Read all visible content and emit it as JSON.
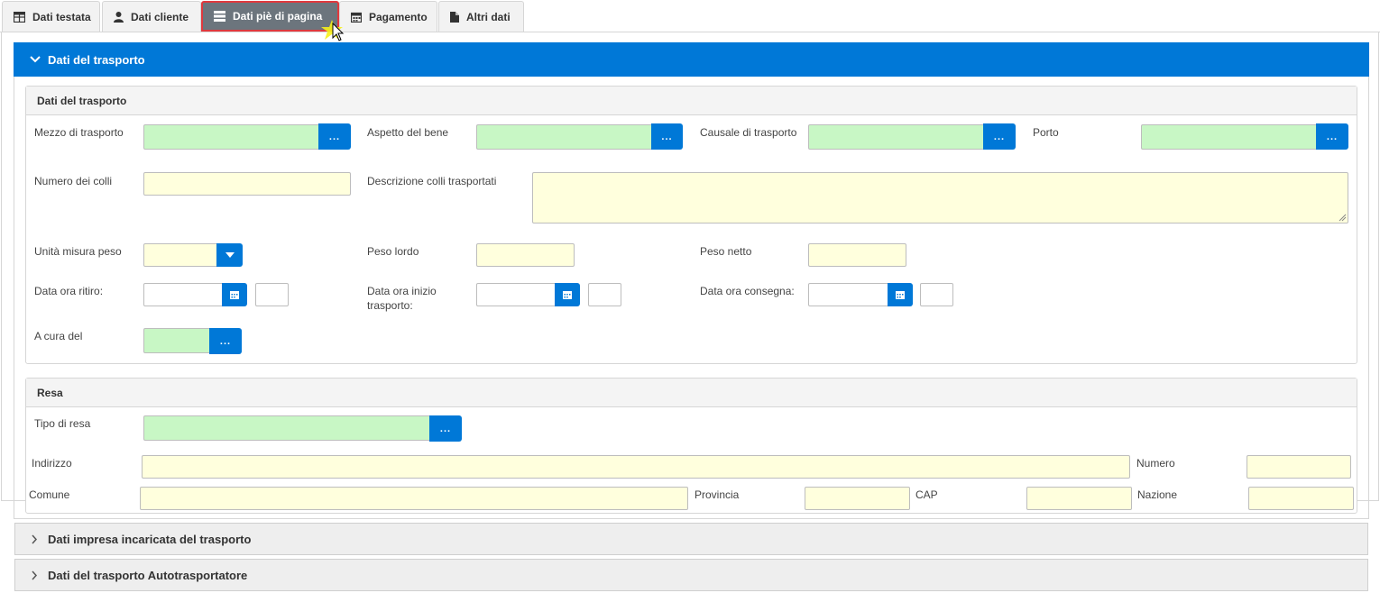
{
  "tabs": [
    {
      "label": "Dati testata",
      "icon": "table-grid-icon"
    },
    {
      "label": "Dati cliente",
      "icon": "user-icon"
    },
    {
      "label": "Dati piè di pagina",
      "icon": "list-icon",
      "active": true
    },
    {
      "label": "Pagamento",
      "icon": "calendar-icon"
    },
    {
      "label": "Altri dati",
      "icon": "document-icon"
    }
  ],
  "accordion": {
    "open_title": "Dati del trasporto",
    "closed": [
      {
        "title": "Dati impresa incaricata del trasporto"
      },
      {
        "title": "Dati del trasporto Autotrasportatore"
      }
    ]
  },
  "transport": {
    "title": "Dati del trasporto",
    "mezzo_label": "Mezzo di trasporto",
    "aspetto_label": "Aspetto del bene",
    "causale_label": "Causale di trasporto",
    "porto_label": "Porto",
    "colli_label": "Numero dei colli",
    "descrizione_label": "Descrizione colli trasportati",
    "unita_label": "Unità misura peso",
    "peso_lordo_label": "Peso lordo",
    "peso_netto_label": "Peso netto",
    "ritiro_label": "Data ora ritiro:",
    "inizio_label": "Data ora inizio trasporto:",
    "consegna_label": "Data ora consegna:",
    "cura_label": "A cura del",
    "lookup_button": "..."
  },
  "resa": {
    "title": "Resa",
    "tipo_label": "Tipo di resa",
    "indirizzo_label": "Indirizzo",
    "numero_label": "Numero",
    "comune_label": "Comune",
    "provincia_label": "Provincia",
    "cap_label": "CAP",
    "nazione_label": "Nazione"
  },
  "colors": {
    "accent": "#0078d7",
    "required_field": "#c8f7c5",
    "optional_field": "#ffffdd",
    "active_tab": "#6c757d",
    "active_tab_outline": "#e0393e"
  }
}
